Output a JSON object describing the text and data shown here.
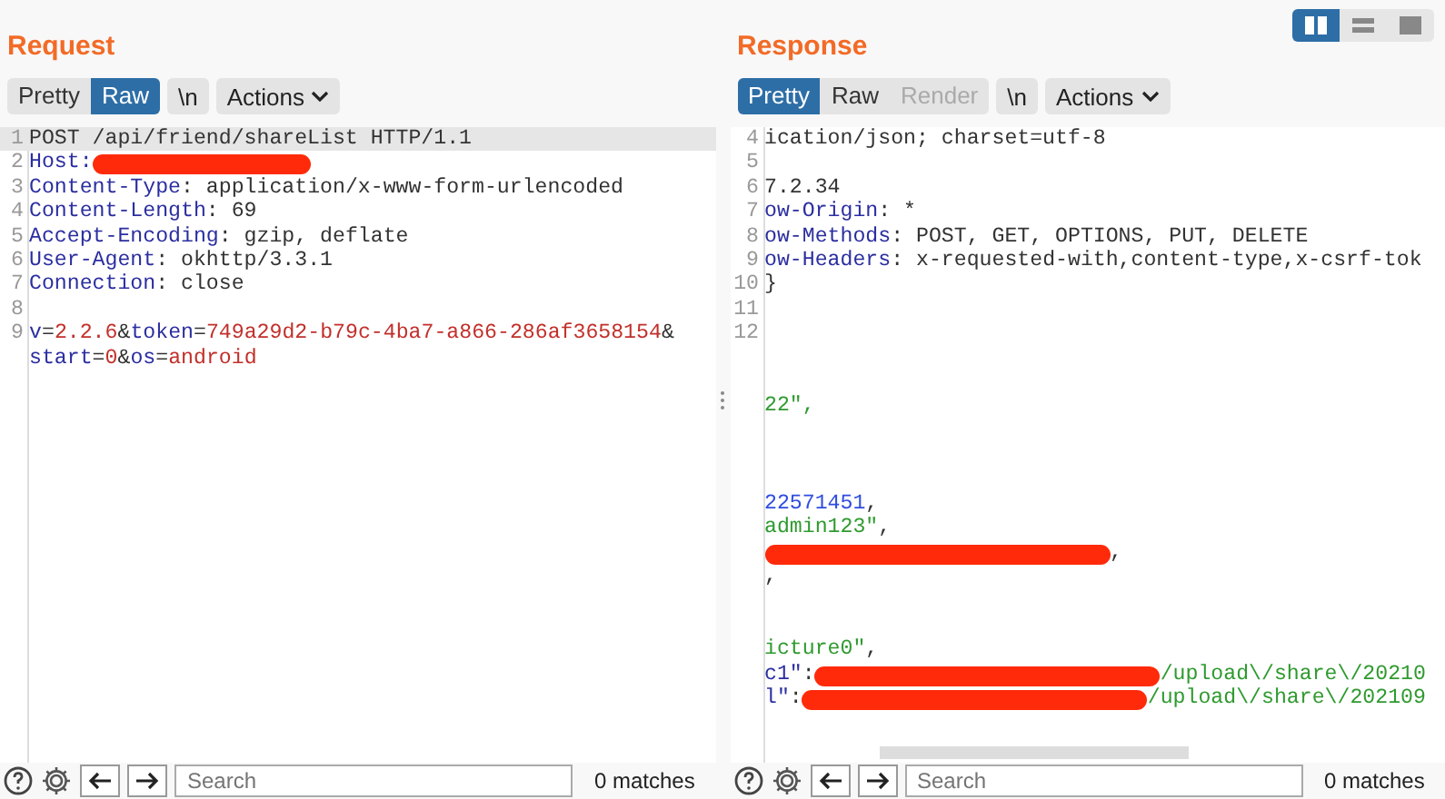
{
  "request": {
    "title": "Request",
    "tabs": [
      {
        "label": "Pretty",
        "selected": false,
        "disabled": false
      },
      {
        "label": "Raw",
        "selected": true,
        "disabled": false
      }
    ],
    "newline_button": "\\n",
    "actions": "Actions",
    "lines": [
      {
        "kind": "code",
        "number": "1",
        "selected": true,
        "segments": [
          {
            "kind": "plain",
            "text": "POST /api/friend/shareList HTTP/1.1"
          }
        ]
      },
      {
        "kind": "code",
        "number": "2",
        "selected": false,
        "segments": [
          {
            "kind": "name",
            "text": "Host:"
          },
          {
            "kind": "redaction"
          }
        ]
      },
      {
        "kind": "code",
        "number": "3",
        "selected": false,
        "segments": [
          {
            "kind": "name",
            "text": "Content-Type"
          },
          {
            "kind": "plain",
            "text": ": application/x-www-form-urlencoded"
          }
        ]
      },
      {
        "kind": "code",
        "number": "4",
        "selected": false,
        "segments": [
          {
            "kind": "name",
            "text": "Content-Length"
          },
          {
            "kind": "plain",
            "text": ": 69"
          }
        ]
      },
      {
        "kind": "code",
        "number": "5",
        "selected": false,
        "segments": [
          {
            "kind": "name",
            "text": "Accept-Encoding"
          },
          {
            "kind": "plain",
            "text": ": gzip, deflate"
          }
        ]
      },
      {
        "kind": "code",
        "number": "6",
        "selected": false,
        "segments": [
          {
            "kind": "name",
            "text": "User-Agent"
          },
          {
            "kind": "plain",
            "text": ": okhttp/3.3.1"
          }
        ]
      },
      {
        "kind": "code",
        "number": "7",
        "selected": false,
        "segments": [
          {
            "kind": "name",
            "text": "Connection"
          },
          {
            "kind": "plain",
            "text": ": close"
          }
        ]
      },
      {
        "kind": "code",
        "number": "8",
        "selected": false
      },
      {
        "kind": "code",
        "number": "9",
        "selected": false,
        "segments": [
          {
            "kind": "key",
            "text": "v"
          },
          {
            "kind": "plain",
            "text": "="
          },
          {
            "kind": "value",
            "text": "2.2.6"
          },
          {
            "kind": "plain",
            "text": "&"
          },
          {
            "kind": "key",
            "text": "token"
          },
          {
            "kind": "plain",
            "text": "="
          },
          {
            "kind": "value",
            "text": "749a29d2-b79c-4ba7-a866-286af3658154"
          },
          {
            "kind": "plain",
            "text": "&"
          }
        ]
      },
      {
        "kind": "code",
        "selected": false,
        "segments": [
          {
            "kind": "key",
            "text": "start"
          },
          {
            "kind": "plain",
            "text": "="
          },
          {
            "kind": "value",
            "text": "0"
          },
          {
            "kind": "plain",
            "text": "&"
          },
          {
            "kind": "key",
            "text": "os"
          },
          {
            "kind": "plain",
            "text": "="
          },
          {
            "kind": "value",
            "text": "android"
          }
        ]
      }
    ],
    "search": {
      "placeholder": "Search"
    },
    "matches": "0 matches"
  },
  "response": {
    "title": "Response",
    "layout_toggle": [
      {
        "kind": "columns",
        "selected": true
      },
      {
        "kind": "rows",
        "selected": false
      },
      {
        "kind": "single",
        "selected": false
      }
    ],
    "tabs": [
      {
        "label": "Pretty",
        "selected": true,
        "disabled": false
      },
      {
        "label": "Raw",
        "selected": false,
        "disabled": false
      },
      {
        "label": "Render",
        "selected": false,
        "disabled": true
      }
    ],
    "newline_button": "\\n",
    "actions": "Actions",
    "lines": [
      {
        "kind": "code",
        "number": "4",
        "selected": false,
        "segments": [
          {
            "kind": "plain",
            "text": "ication/json; charset=utf-8"
          }
        ]
      },
      {
        "kind": "code",
        "number": "5",
        "selected": false
      },
      {
        "kind": "code",
        "number": "6",
        "selected": false,
        "segments": [
          {
            "kind": "plain",
            "text": "7.2.34"
          }
        ]
      },
      {
        "kind": "code",
        "number": "7",
        "selected": false,
        "segments": [
          {
            "kind": "name",
            "text": "ow-Origin"
          },
          {
            "kind": "plain",
            "text": ": *"
          }
        ]
      },
      {
        "kind": "code",
        "number": "8",
        "selected": false,
        "segments": [
          {
            "kind": "name",
            "text": "ow-Methods"
          },
          {
            "kind": "plain",
            "text": ": POST, GET, OPTIONS, PUT, DELETE"
          }
        ]
      },
      {
        "kind": "code",
        "number": "9",
        "selected": false,
        "segments": [
          {
            "kind": "name",
            "text": "ow-Headers"
          },
          {
            "kind": "plain",
            "text": ": x-requested-with,content-type,x-csrf-tok"
          }
        ]
      },
      {
        "kind": "code",
        "number": "10",
        "selected": false,
        "segments": [
          {
            "kind": "plain",
            "text": "}"
          }
        ]
      },
      {
        "kind": "code",
        "number": "11",
        "selected": false
      },
      {
        "kind": "code",
        "number": "12",
        "selected": false
      },
      {
        "kind": "blank"
      },
      {
        "kind": "blank"
      },
      {
        "kind": "code",
        "selected": false,
        "segments": [
          {
            "kind": "string",
            "text": "22\","
          }
        ]
      },
      {
        "kind": "blank"
      },
      {
        "kind": "blank"
      },
      {
        "kind": "blank"
      },
      {
        "kind": "code",
        "selected": false,
        "segments": [
          {
            "kind": "number",
            "text": "22571451"
          },
          {
            "kind": "plain",
            "text": ","
          }
        ]
      },
      {
        "kind": "code",
        "selected": false,
        "segments": [
          {
            "kind": "string",
            "text": "admin123\""
          },
          {
            "kind": "plain",
            "text": ","
          }
        ]
      },
      {
        "kind": "code",
        "selected": false,
        "segments": [
          {
            "kind": "redaction"
          },
          {
            "kind": "plain",
            "text": ","
          }
        ]
      },
      {
        "kind": "code",
        "selected": false,
        "segments": [
          {
            "kind": "plain",
            "text": ","
          }
        ]
      },
      {
        "kind": "blank"
      },
      {
        "kind": "blank"
      },
      {
        "kind": "code",
        "selected": false,
        "segments": [
          {
            "kind": "string",
            "text": "icture0\""
          },
          {
            "kind": "plain",
            "text": ","
          }
        ]
      },
      {
        "kind": "code",
        "selected": false,
        "segments": [
          {
            "kind": "name",
            "text": "c1\""
          },
          {
            "kind": "plain",
            "text": ":"
          },
          {
            "kind": "redaction"
          },
          {
            "kind": "string",
            "text": "/upload\\/share\\/20210"
          }
        ]
      },
      {
        "kind": "code",
        "selected": false,
        "segments": [
          {
            "kind": "name",
            "text": "l\""
          },
          {
            "kind": "plain",
            "text": ":"
          },
          {
            "kind": "redaction"
          },
          {
            "kind": "string",
            "text": "/upload\\/share\\/202109"
          }
        ]
      }
    ],
    "search": {
      "placeholder": "Search"
    },
    "matches": "0 matches"
  }
}
